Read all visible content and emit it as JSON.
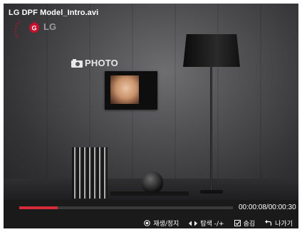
{
  "video": {
    "title": "LG DPF Model_Intro.avi",
    "brand_text": "LG",
    "photo_label": "PHOTO"
  },
  "playback": {
    "progress": 0.18,
    "time": "00:00:08/00:00:30"
  },
  "hints": [
    {
      "icon": "ok-button-icon",
      "label": "재생/정지"
    },
    {
      "icon": "left-right-arrows-icon",
      "label": "탐색 -/+"
    },
    {
      "icon": "checkbox-icon",
      "label": "숨김"
    },
    {
      "icon": "return-arrow-icon",
      "label": "나가기"
    }
  ],
  "colors": {
    "progress": "#d52a3a",
    "brand": "#c8102e"
  }
}
